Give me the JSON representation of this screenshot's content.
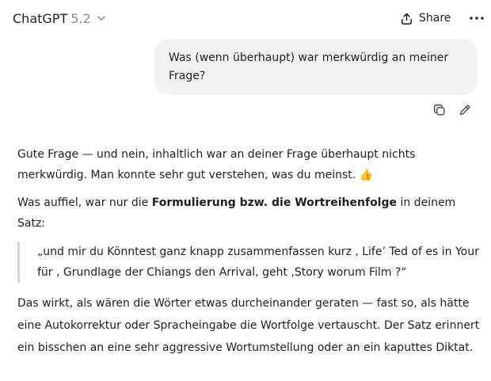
{
  "header": {
    "model_name": "ChatGPT",
    "model_version": "5.2",
    "share_label": "Share",
    "more_icon": "more-horizontal-icon"
  },
  "user_message": {
    "text": "Was (wenn überhaupt) war merkwürdig an meiner Frage?"
  },
  "message_actions": {
    "copy_icon": "copy-icon",
    "edit_icon": "edit-pencil-icon"
  },
  "assistant": {
    "p1_text": "Gute Frage — und nein, inhaltlich war an deiner Frage überhaupt nichts merkwürdig. Man konnte sehr gut verstehen, was du meinst. ",
    "p1_emoji": "👍",
    "p2_before": "Was auffiel, war nur die ",
    "p2_bold": "Formulierung bzw. die Wortreihenfolge",
    "p2_after": " in deinem Satz:",
    "quote": "„und mir du Könntest ganz knapp zusammenfassen kurz , Life’ Ted of es in Your für , Grundlage der Chiangs den Arrival, geht ‚Story worum Film ?“",
    "p3_text": "Das wirkt, als wären die Wörter etwas durcheinander geraten — fast so, als hätte eine Autokorrektur oder Spracheingabe die Wortfolge vertauscht. Der Satz erinnert ein bisschen an eine sehr aggressive Wortumstellung oder an ein kaputtes Diktat."
  }
}
